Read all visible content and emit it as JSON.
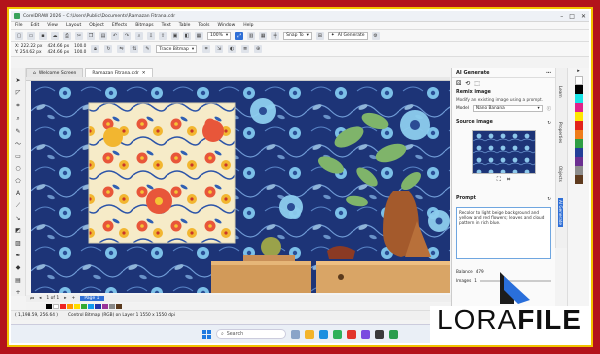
{
  "window": {
    "title": "CorelDRAW 2026 – C:\\Users\\Public\\Documents\\Ramazan Fitrana.cdr"
  },
  "menu": [
    "File",
    "Edit",
    "View",
    "Layout",
    "Object",
    "Effects",
    "Bitmaps",
    "Text",
    "Table",
    "Tools",
    "Window",
    "Help"
  ],
  "toolbar": {
    "zoom": "100%",
    "snap_to": "Snap To",
    "ai_generate": "AI Generate"
  },
  "propbar": {
    "x": "X: 222.22 px",
    "y": "Y: 254.62 px",
    "w": "424.66 px",
    "h": "424.66 px",
    "scale_w": "100.0",
    "scale_h": "100.0",
    "trace": "Trace Bitmap"
  },
  "tabs": [
    {
      "label": "Welcome Screen"
    },
    {
      "label": "Ramazan Fitrana.cdr"
    }
  ],
  "ai_panel": {
    "header": "AI Generate",
    "remix_title": "Remix image",
    "remix_desc": "Modify an existing image using a prompt.",
    "model_label": "Model",
    "model_value": "Nano Banana",
    "source_title": "Source image",
    "prompt_title": "Prompt",
    "prompt_text": "Recolor to light beige background and yellow and red flowers; leaves and cloud pattern in rich blue.",
    "balance_label": "Balance",
    "balance_value": "479",
    "images_label": "Images",
    "images_value": "1"
  },
  "docker_tabs": [
    "Learn",
    "Properties",
    "Objects",
    "AI Generate"
  ],
  "pagebar": {
    "page_label": "Page 1"
  },
  "status": {
    "coords": "( 1,198.59, 256.64 )",
    "object": "Control Bitmap (RGB) on Layer 1  1550 x 1550 dpi",
    "fill": "None",
    "outline": "None"
  },
  "taskbar": {
    "search_placeholder": "Search"
  },
  "watermark": {
    "part1": "LORA",
    "part2": "FILE"
  }
}
